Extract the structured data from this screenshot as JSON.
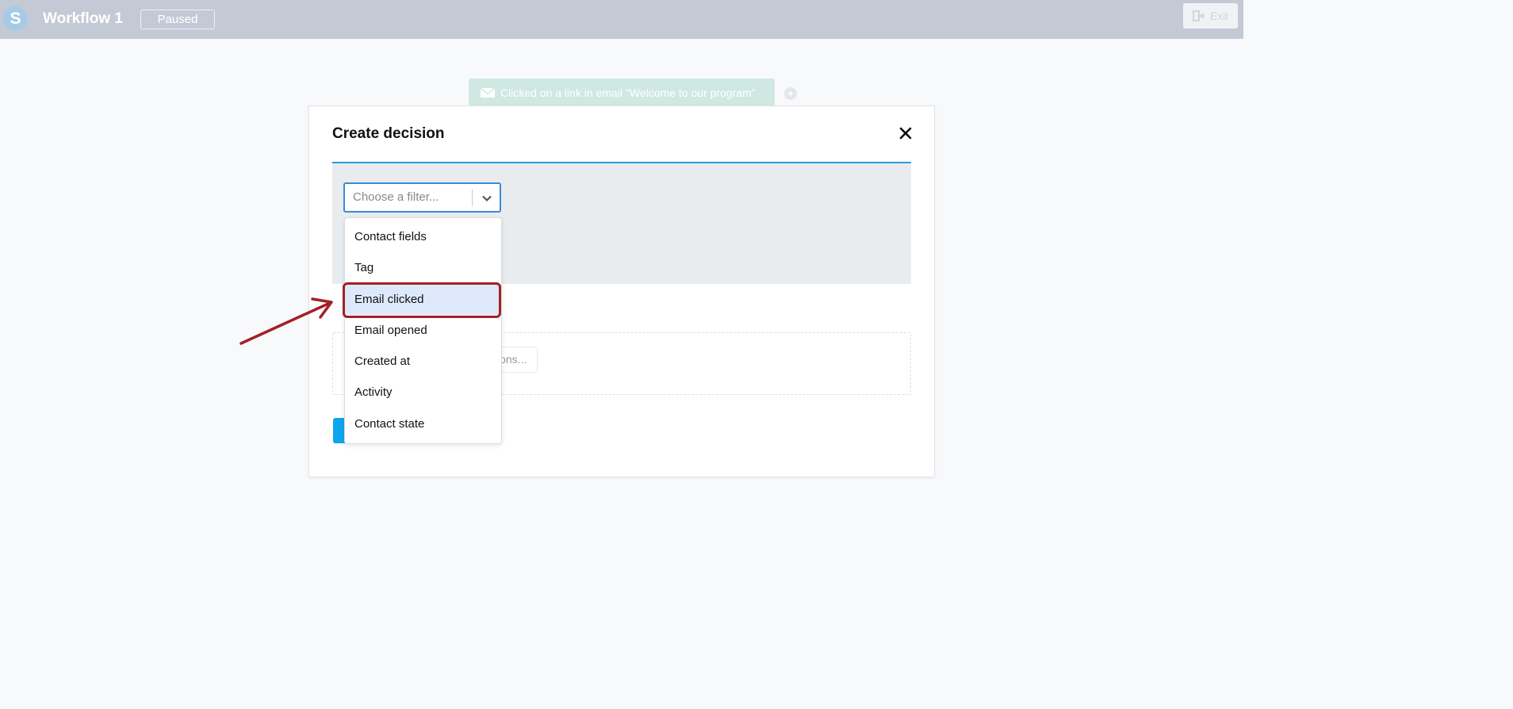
{
  "header": {
    "logo_letter": "S",
    "title": "Workflow 1",
    "status": "Paused",
    "exit_label": "Exit"
  },
  "canvas": {
    "trigger_label": "Clicked on a link in email \"Welcome to our program\"",
    "add_node": "+"
  },
  "modal": {
    "title": "Create decision",
    "filter_placeholder": "Choose a filter...",
    "actions_hint": "ions..."
  },
  "dropdown": {
    "items": [
      "Contact fields",
      "Tag",
      "Email clicked",
      "Email opened",
      "Created at",
      "Activity",
      "Contact state"
    ],
    "highlighted": "Email clicked"
  },
  "colors": {
    "topbar": "#c4c9d6",
    "accent": "#2a9ad8",
    "annotation": "#a32024",
    "trigger": "#cfe9e2"
  }
}
